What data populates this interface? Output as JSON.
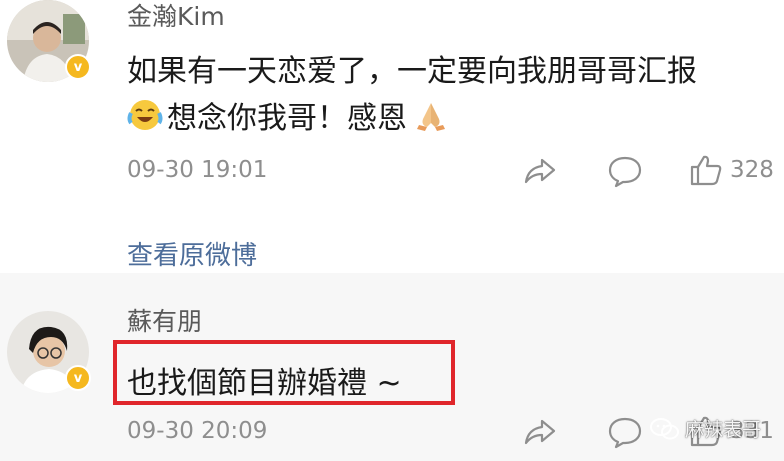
{
  "comments": [
    {
      "username": "金瀚Kim",
      "content_line1": "如果有一天恋爱了，一定要向我朋哥哥汇报",
      "content_line2": "想念你我哥！感恩",
      "time": "09-30 19:01",
      "like_count": "328",
      "view_original": "查看原微博"
    },
    {
      "username": "蘇有朋",
      "content": "也找個節目辦婚禮 ~",
      "time": "09-30 20:09",
      "like_count": "331"
    }
  ],
  "watermark": "麻辣表哥",
  "colors": {
    "highlight": "#e0262b",
    "verified": "#f5b81f",
    "link": "#4d6d9a"
  },
  "icons": [
    "verified-badge-icon",
    "share-icon",
    "comment-icon",
    "like-icon",
    "crying-laughing-emoji",
    "praying-hands-emoji",
    "wechat-icon"
  ]
}
